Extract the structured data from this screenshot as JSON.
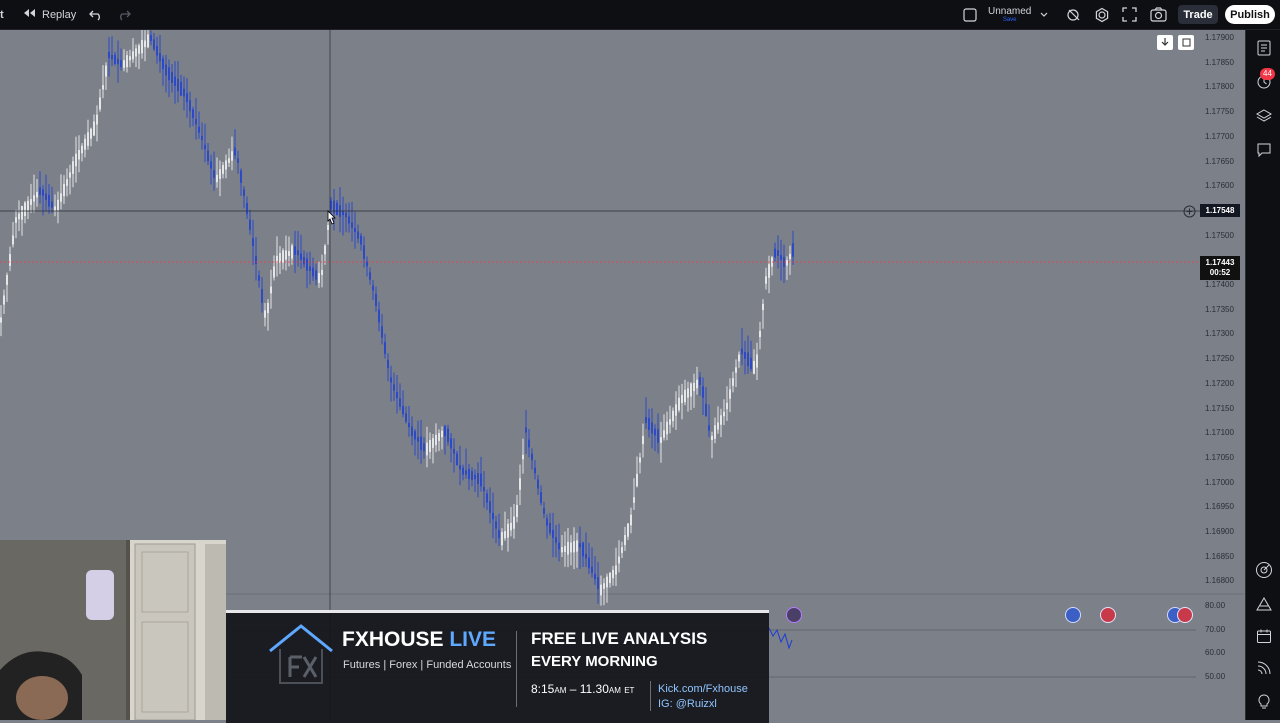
{
  "topbar": {
    "left_text": "t",
    "replay_label": "Replay",
    "layout_name": "Unnamed",
    "layout_sub": "Save",
    "trade_label": "Trade",
    "publish_label": "Publish"
  },
  "price_axis": {
    "ticks": [
      "1.17900",
      "1.17850",
      "1.17800",
      "1.17750",
      "1.17700",
      "1.17650",
      "1.17600",
      "1.17550",
      "1.17500",
      "1.17450",
      "1.17400",
      "1.17350",
      "1.17300",
      "1.17250",
      "1.17200",
      "1.17150",
      "1.17100",
      "1.17050",
      "1.17000",
      "1.16950",
      "1.16900",
      "1.16850",
      "1.16800"
    ],
    "hover_price": "1.17548",
    "current_price": "1.17443",
    "countdown": "00:52"
  },
  "osc_axis": {
    "ticks": [
      "80.00",
      "70.00",
      "60.00",
      "50.00"
    ]
  },
  "notifications_count": "44",
  "banner": {
    "brand": "FXHOUSE",
    "brand_live": "LIVE",
    "tagline": "Futures | Forex | Funded Accounts",
    "headline_1": "FREE LIVE ANALYSIS",
    "headline_2": "EVERY MORNING",
    "time_start": "8:15",
    "am1": "AM",
    "dash": "–",
    "time_end": "11.30",
    "am2": "AM",
    "tz": "ET",
    "kick": "Kick.com/Fxhouse",
    "ig": "IG: @Ruizxl"
  },
  "colors": {
    "chart_bg": "#7b8089",
    "candle_up": "#ffffff",
    "candle_down": "#1a3cd6",
    "current_line": "#f23645",
    "panel_bg": "#0e0f12",
    "brand_blue": "#5ea8ff",
    "link_blue": "#8ec5ff"
  },
  "icons": [
    "replay-icon",
    "undo-icon",
    "redo-icon",
    "layout-icon",
    "chevron-down-icon",
    "indicator-icon",
    "settings-icon",
    "fullscreen-icon",
    "camera-icon",
    "watchlist-icon",
    "alerts-icon",
    "layers-icon",
    "chat-icon",
    "target-icon",
    "triangle-icon",
    "calendar-icon",
    "rss-icon",
    "lightbulb-icon"
  ]
}
